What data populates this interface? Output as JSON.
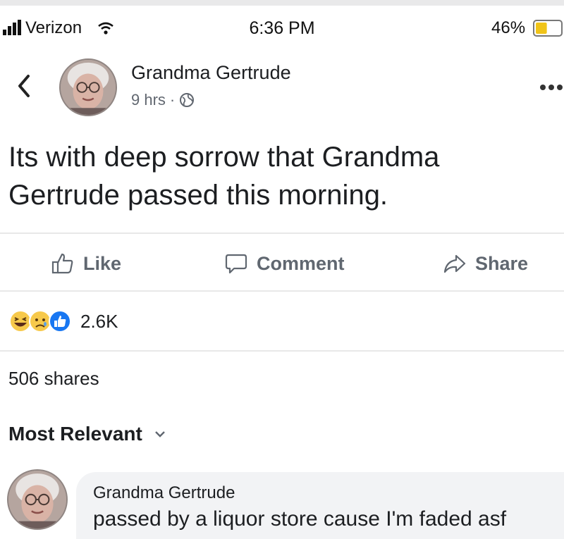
{
  "status_bar": {
    "carrier": "Verizon",
    "time": "6:36 PM",
    "battery_percent": "46%",
    "battery_level": 0.46,
    "icons": [
      "signal-icon",
      "wifi-icon",
      "battery-icon"
    ]
  },
  "post": {
    "author": "Grandma Gertrude",
    "time_ago": "9 hrs",
    "separator": "·",
    "audience_icon": "globe-icon",
    "text": "Its with deep sorrow that Grandma Gertrude passed this morning."
  },
  "actions": {
    "like": "Like",
    "comment": "Comment",
    "share": "Share"
  },
  "reactions": {
    "icons": [
      "haha-reaction-icon",
      "sad-reaction-icon",
      "like-reaction-icon"
    ],
    "count": "2.6K"
  },
  "shares": "506 shares",
  "comments": {
    "sort_label": "Most Relevant",
    "items": [
      {
        "author": "Grandma Gertrude",
        "text": "passed by a liquor store cause I'm faded asf"
      }
    ]
  },
  "colors": {
    "text": "#1c1e21",
    "secondary": "#616770",
    "bubble": "#f2f3f5",
    "like_blue": "#1877f2",
    "reaction_yellow": "#f7c94b"
  }
}
